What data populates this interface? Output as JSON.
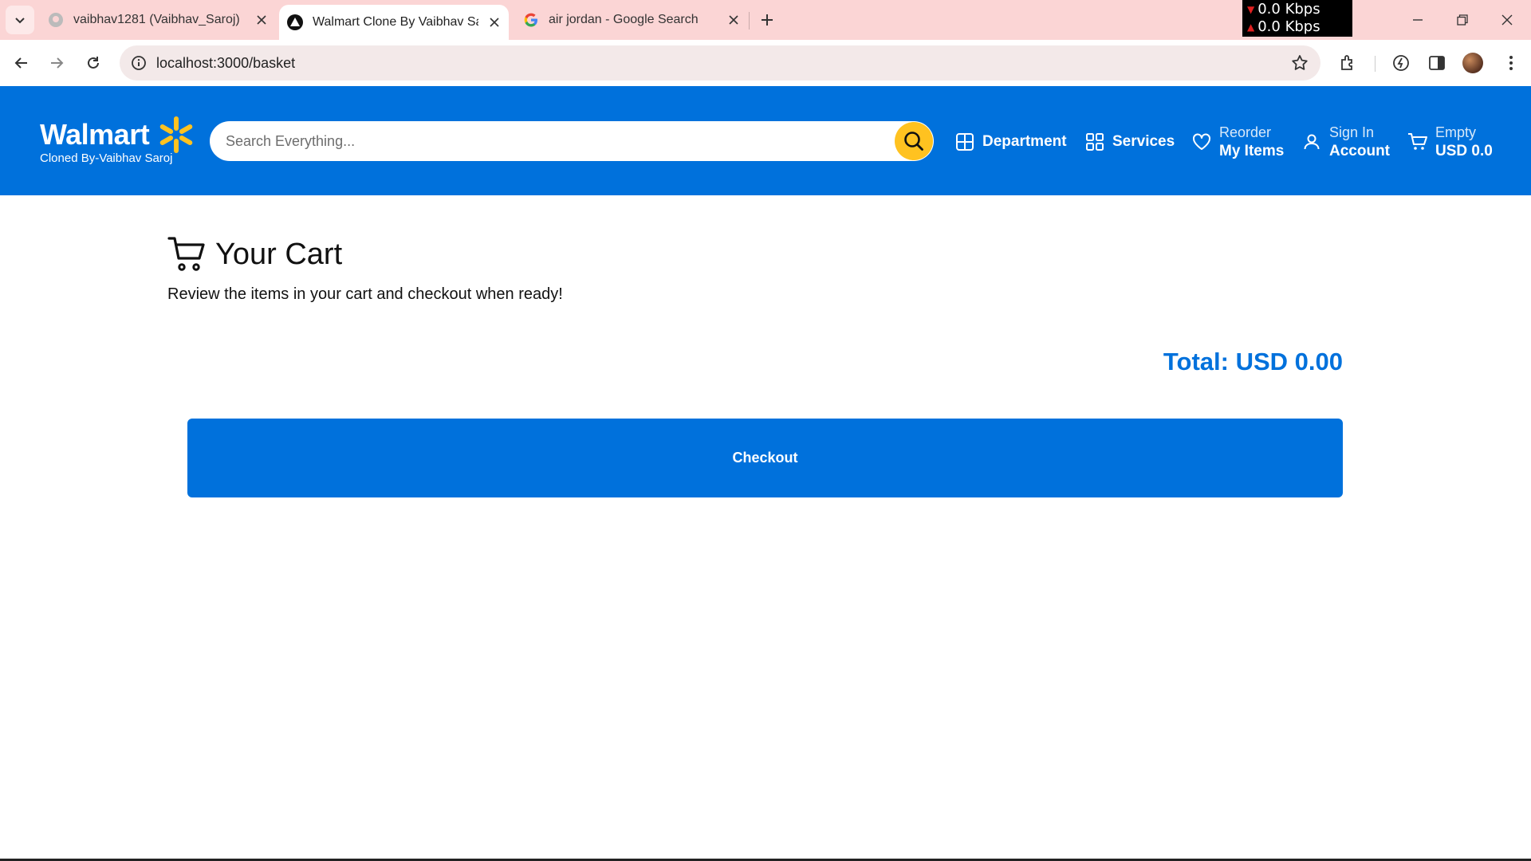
{
  "browser": {
    "tabs": [
      {
        "title": "vaibhav1281 (Vaibhav_Saroj)",
        "icon": "github-icon",
        "active": false
      },
      {
        "title": "Walmart Clone By Vaibhav Saroj",
        "icon": "app-triangle-icon",
        "active": true
      },
      {
        "title": "air jordan - Google Search",
        "icon": "google-icon",
        "active": false
      }
    ],
    "net_down": "0.0 Kbps",
    "net_up": "0.0 Kbps",
    "url": "localhost:3000/basket"
  },
  "header": {
    "logo_word": "Walmart",
    "logo_sub": "Cloned By-Vaibhav Saroj",
    "search_placeholder": "Search Everything...",
    "nav": {
      "department": "Department",
      "services": "Services",
      "reorder_small": "Reorder",
      "reorder_big": "My Items",
      "signin_small": "Sign In",
      "signin_big": "Account",
      "cart_small": "Empty",
      "cart_big": "USD 0.0"
    },
    "colors": {
      "brand": "#0071dc",
      "spark": "#ffc220"
    }
  },
  "main": {
    "title": "Your Cart",
    "subtitle": "Review the items in your cart and checkout when ready!",
    "total": "Total: USD 0.00",
    "checkout_label": "Checkout"
  }
}
